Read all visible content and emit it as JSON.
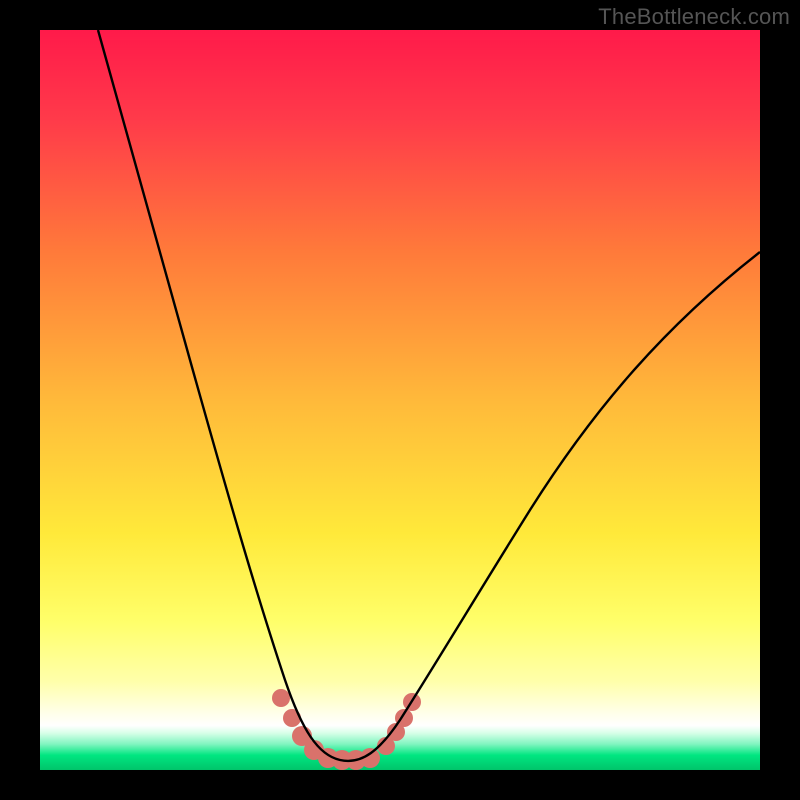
{
  "watermark": "TheBottleneck.com",
  "colors": {
    "red": "#ff1a4a",
    "orange": "#ff9a3a",
    "yellow": "#ffe93a",
    "lightyellow": "#ffff9a",
    "white": "#ffffff",
    "green": "#00e681",
    "deepgreen": "#00c46a",
    "dot": "#d9726b",
    "curve": "#000000"
  },
  "chart_data": {
    "type": "line",
    "title": "",
    "xlabel": "",
    "ylabel": "",
    "xlim": [
      0,
      100
    ],
    "ylim": [
      0,
      100
    ],
    "series": [
      {
        "name": "bottleneck-curve",
        "x": [
          8,
          12,
          16,
          20,
          24,
          28,
          30,
          32,
          34,
          36,
          37,
          38,
          39,
          40,
          42,
          44,
          46,
          48,
          50,
          55,
          60,
          65,
          70,
          80,
          90,
          100
        ],
        "values": [
          100,
          88,
          76,
          63,
          49,
          33,
          25,
          17,
          10,
          4,
          2,
          1,
          1,
          1,
          1,
          2,
          4,
          8,
          12,
          22,
          31,
          39,
          45,
          55,
          63,
          70
        ]
      }
    ],
    "markers": {
      "name": "highlighted-points",
      "x": [
        34,
        36,
        37,
        38,
        39,
        40,
        41,
        42,
        44,
        46,
        47,
        48
      ],
      "values": [
        10,
        4,
        2,
        1,
        1,
        1,
        1,
        1,
        2,
        4,
        6,
        8
      ]
    }
  }
}
